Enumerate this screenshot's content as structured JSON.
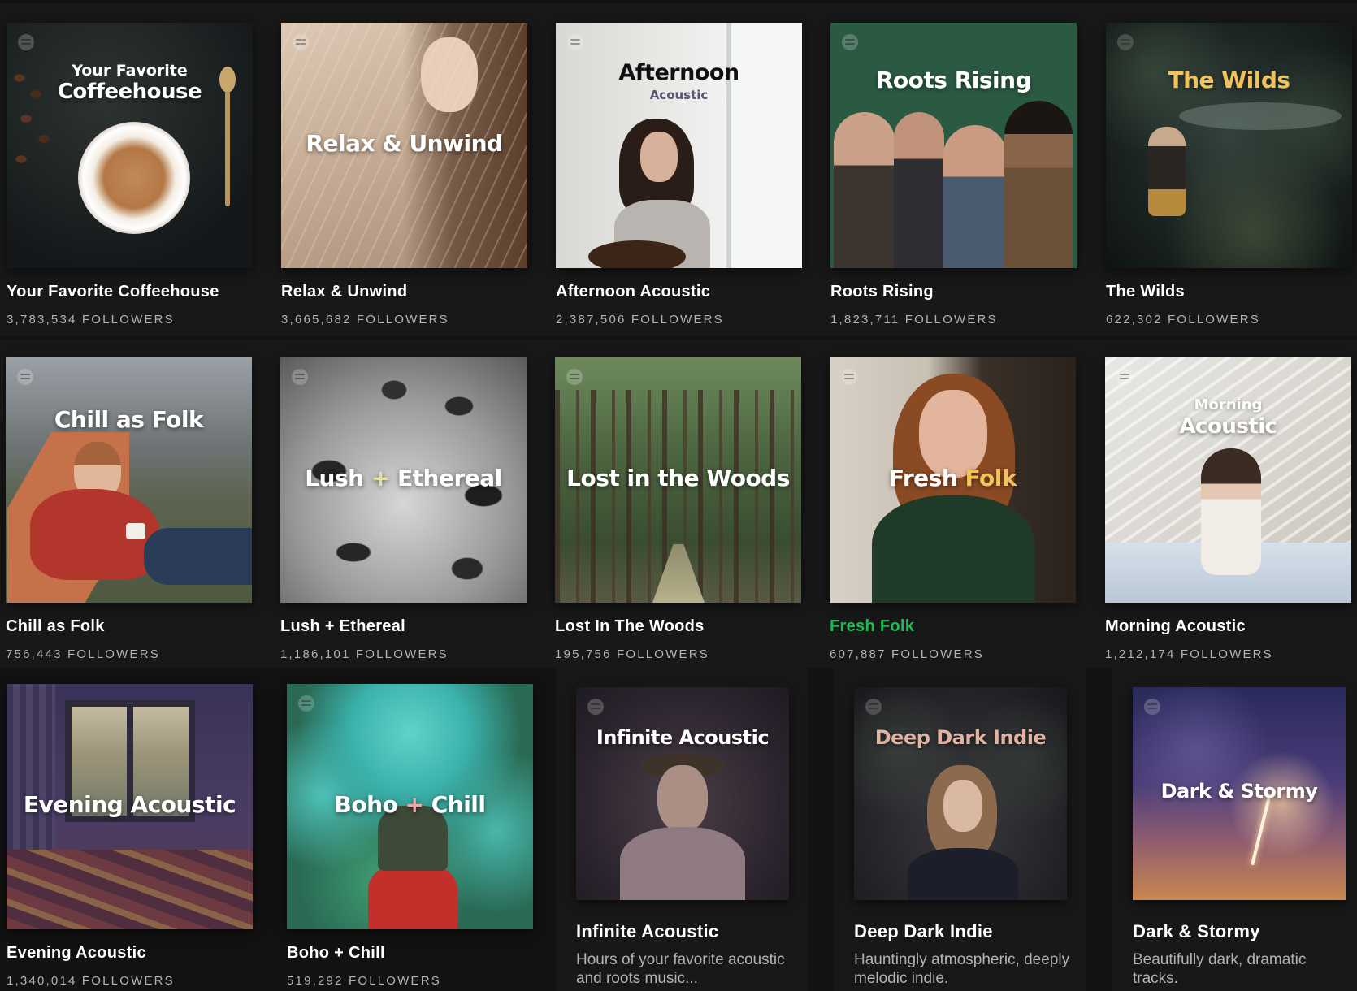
{
  "colors": {
    "background": "#121212",
    "active_title": "#1db954",
    "meta_text": "#b3b3b3"
  },
  "playlists": [
    {
      "cover_small": "Your Favorite",
      "cover_title": "Coffeehouse",
      "title": "Your Favorite Coffeehouse",
      "followers": "3,783,534 FOLLOWERS"
    },
    {
      "cover_title": "Relax & Unwind",
      "title": "Relax & Unwind",
      "followers": "3,665,682 FOLLOWERS"
    },
    {
      "cover_title": "Afternoon",
      "cover_small": "Acoustic",
      "title": "Afternoon Acoustic",
      "followers": "2,387,506 FOLLOWERS"
    },
    {
      "cover_title": "Roots Rising",
      "title": "Roots Rising",
      "followers": "1,823,711 FOLLOWERS"
    },
    {
      "cover_title": "The Wilds",
      "title": "The Wilds",
      "followers": "622,302 FOLLOWERS"
    },
    {
      "cover_title": "Chill as Folk",
      "title": "Chill as Folk",
      "followers": "756,443 FOLLOWERS"
    },
    {
      "cover_title_a": "Lush",
      "cover_title_plus": "+",
      "cover_title_b": "Ethereal",
      "title": "Lush + Ethereal",
      "followers": "1,186,101 FOLLOWERS"
    },
    {
      "cover_title": "Lost in the Woods",
      "title": "Lost In The Woods",
      "followers": "195,756 FOLLOWERS"
    },
    {
      "cover_title_a": "Fresh",
      "cover_title_b": "Folk",
      "title": "Fresh Folk",
      "followers": "607,887 FOLLOWERS"
    },
    {
      "cover_small": "Morning",
      "cover_title": "Acoustic",
      "title": "Morning Acoustic",
      "followers": "1,212,174 FOLLOWERS"
    },
    {
      "cover_title": "Evening Acoustic",
      "title": "Evening Acoustic",
      "followers": "1,340,014 FOLLOWERS"
    },
    {
      "cover_title_a": "Boho",
      "cover_title_plus": "+",
      "cover_title_b": "Chill",
      "title": "Boho + Chill",
      "followers": "519,292 FOLLOWERS"
    },
    {
      "cover_title": "Infinite Acoustic",
      "title": "Infinite Acoustic",
      "description": "Hours of your favorite acoustic and roots music..."
    },
    {
      "cover_title": "Deep Dark Indie",
      "title": "Deep Dark Indie",
      "description": "Hauntingly atmospheric, deeply melodic indie."
    },
    {
      "cover_title": "Dark & Stormy",
      "title": "Dark & Stormy",
      "description": "Beautifully dark, dramatic tracks."
    }
  ]
}
